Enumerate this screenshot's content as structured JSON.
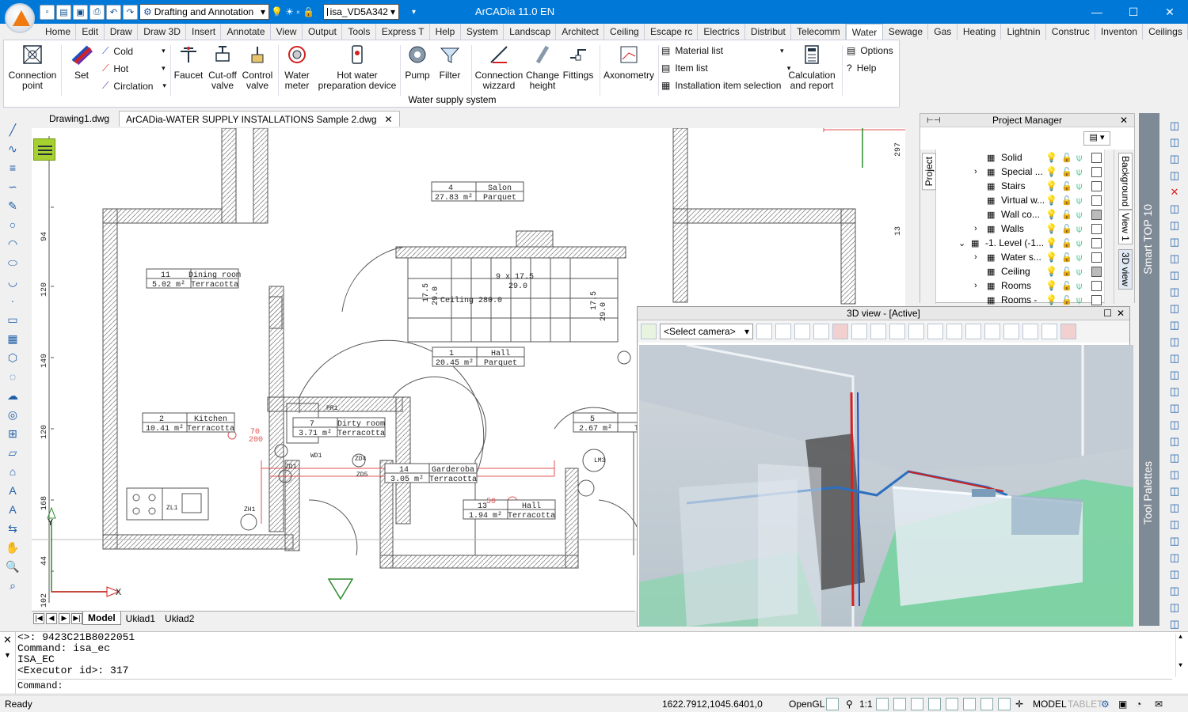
{
  "app": {
    "title": "ArCADia 11.0 EN",
    "workspace": "Drafting and Annotation",
    "layer_combo": "isa_VD5A342"
  },
  "menu_tabs": [
    "Home",
    "Edit",
    "Draw",
    "Draw 3D",
    "Insert",
    "Annotate",
    "View",
    "Output",
    "Tools",
    "Express T",
    "Help",
    "System",
    "Landscap",
    "Architect",
    "Ceiling",
    "Escape rc",
    "Electrics",
    "Distribut",
    "Telecomm",
    "Water",
    "Sewage",
    "Gas",
    "Heating",
    "Lightnin",
    "Construc",
    "Inventon",
    "Ceilings"
  ],
  "ribbon": {
    "connection_point": "Connection point",
    "set": "Set",
    "cold": "Cold",
    "hot": "Hot",
    "circulation": "Circlation",
    "faucet": "Faucet",
    "cutoff_valve": "Cut-off valve",
    "control_valve": "Control valve",
    "water_meter": "Water meter",
    "hot_water_device": "Hot water preparation device",
    "pump": "Pump",
    "filter": "Filter",
    "connection_wizard": "Connection wizzard",
    "change_height": "Change height",
    "fittings": "Fittings",
    "axonometry": "Axonometry",
    "material_list": "Material list",
    "item_list": "Item list",
    "installation_selection": "Installation item selection",
    "calculation": "Calculation and report",
    "options": "Options",
    "help": "Help",
    "group_label": "Water supply system"
  },
  "doc_tabs": [
    "Drawing1.dwg",
    "ArCADia-WATER SUPPLY INSTALLATIONS Sample 2.dwg"
  ],
  "drawing": {
    "rooms": [
      {
        "num": "4",
        "name": "Salon",
        "area": "27.83 m²",
        "floor": "Parquet"
      },
      {
        "num": "11",
        "name": "Dining room",
        "area": "5.02 m²",
        "floor": "Terracotta"
      },
      {
        "num": "1",
        "name": "Hall",
        "area": "20.45 m²",
        "floor": "Parquet"
      },
      {
        "num": "2",
        "name": "Kitchen",
        "area": "10.41 m²",
        "floor": "Terracotta"
      },
      {
        "num": "7",
        "name": "Dirty room",
        "area": "3.71 m²",
        "floor": "Terracotta"
      },
      {
        "num": "5",
        "name": "",
        "area": "2.67 m²",
        "floor": "Ter"
      },
      {
        "num": "14",
        "name": "Garderoba",
        "area": "3.05 m²",
        "floor": "Terracotta"
      },
      {
        "num": "13",
        "name": "Hall",
        "area": "1.94 m²",
        "floor": "Terracotta"
      }
    ],
    "dims": [
      "94",
      "120",
      "149",
      "120",
      "168",
      "44",
      "102",
      "297",
      "13",
      "17.5",
      "29.0",
      "17.5",
      "29.0",
      "70",
      "200",
      "50"
    ],
    "labels": [
      "Ceiling 280.0",
      "9 x 17.5",
      "29.0",
      "PR1",
      "ZL1",
      "ZH1",
      "ZD1",
      "ZD4",
      "ZD5",
      "WD1",
      "LM3",
      "Y",
      "X"
    ]
  },
  "layout_tabs": [
    "Model",
    "Układ1",
    "Układ2"
  ],
  "project_manager": {
    "title": "Project Manager",
    "tabs": [
      "Project",
      "Background",
      "View 1",
      "3D view"
    ],
    "rows": [
      "Solid",
      "Special ...",
      "Stairs",
      "Virtual w...",
      "Wall co...",
      "Walls",
      "-1. Level (-1...",
      "Water s...",
      "Ceiling",
      "Rooms",
      "Rooms -"
    ]
  },
  "view3d": {
    "title": "3D view - [Active]",
    "camera": "<Select camera>"
  },
  "side_labels": {
    "smart": "Smart TOP 10",
    "palettes": "Tool Palettes"
  },
  "command": {
    "lines": [
      "<>: 9423C21B8022051",
      "Command: isa_ec",
      "ISA_EC",
      "<Executor id>: 317"
    ],
    "prompt": "Command:"
  },
  "status": {
    "ready": "Ready",
    "coords": "1622.7912,1045.6401,0",
    "opengl": "OpenGL",
    "scale": "1:1",
    "model": "MODEL",
    "tablet": "TABLET"
  }
}
